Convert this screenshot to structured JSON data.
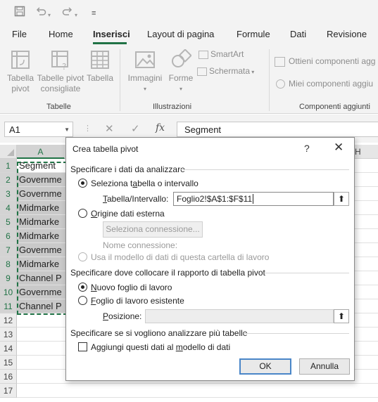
{
  "quick_access": {
    "save_icon": "save-icon",
    "undo_icon": "undo-icon",
    "redo_icon": "redo-icon",
    "customize_icon": "customize-icon"
  },
  "tabs": [
    {
      "label": "File",
      "active": false
    },
    {
      "label": "Home",
      "active": false
    },
    {
      "label": "Inserisci",
      "active": true
    },
    {
      "label": "Layout di pagina",
      "active": false
    },
    {
      "label": "Formule",
      "active": false
    },
    {
      "label": "Dati",
      "active": false
    },
    {
      "label": "Revisione",
      "active": false
    }
  ],
  "ribbon": {
    "tabella_pivot": "Tabella pivot",
    "tabelle_pivot_consigliate": "Tabelle pivot consigliate",
    "tabella": "Tabella",
    "immagini": "Immagini",
    "forme": "Forme",
    "smartart": "SmartArt",
    "schermata": "Schermata",
    "ottieni_componenti": "Ottieni componenti agg",
    "miei_componenti": "Miei componenti aggiu",
    "group_tabelle": "Tabelle",
    "group_illustrazioni": "Illustrazioni",
    "group_componenti": "Componenti aggiunti"
  },
  "formula_bar": {
    "name_box": "A1",
    "cancel_icon": "✕",
    "enter_icon": "✓",
    "fx_label": "fx",
    "value": "Segment"
  },
  "grid": {
    "col_a": "A",
    "col_h": "H",
    "rows": [
      "1",
      "2",
      "3",
      "4",
      "5",
      "6",
      "7",
      "8",
      "9",
      "10",
      "11",
      "12",
      "13",
      "14",
      "15",
      "16",
      "17"
    ],
    "col_a_values": [
      "Segment",
      "Governme",
      "Governme",
      "Midmarke",
      "Midmarke",
      "Midmarke",
      "Governme",
      "Midmarke",
      "Channel P",
      "Governme",
      "Channel P",
      "",
      "",
      "",
      "",
      "",
      ""
    ]
  },
  "dialog": {
    "title": "Crea tabella pivot",
    "help": "?",
    "close": "✕",
    "section1": "Specificare i dati da analizzare",
    "opt_select_a": "Seleziona t",
    "opt_select_u": "a",
    "opt_select_b": "bella o intervallo",
    "range_label_a": "",
    "range_label_u": "T",
    "range_label_b": "abella/Intervallo:",
    "range_value": "Foglio2!$A$1:$F$11",
    "opt_external_a": "",
    "opt_external_u": "O",
    "opt_external_b": "rigine dati esterna",
    "choose_connection": "Seleziona connessione...",
    "connection_name": "Nome connessione:",
    "opt_datamodel": "Usa il modello di dati di questa cartella di lavoro",
    "section2": "Specificare dove collocare il rapporto di tabella pivot",
    "opt_new_sheet_a": "",
    "opt_new_sheet_u": "N",
    "opt_new_sheet_b": "uovo foglio di lavoro",
    "opt_existing_a": "",
    "opt_existing_u": "F",
    "opt_existing_b": "oglio di lavoro esistente",
    "position_label_a": "",
    "position_label_u": "P",
    "position_label_b": "osizione:",
    "position_value": "",
    "section3": "Specificare se si vogliono analizzare più tabelle",
    "chk_datamodel_a": "Aggiungi questi dati al ",
    "chk_datamodel_u": "m",
    "chk_datamodel_b": "odello di dati",
    "ok": "OK",
    "cancel": "Annulla"
  }
}
